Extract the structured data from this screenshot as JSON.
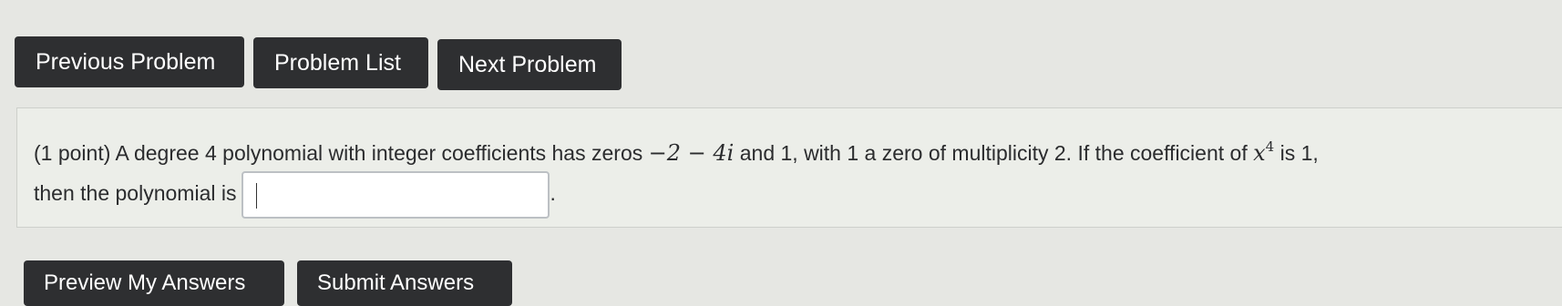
{
  "nav": {
    "previous_label": "Previous Problem",
    "list_label": "Problem List",
    "next_label": "Next Problem"
  },
  "problem": {
    "points": "(1 point)",
    "text_part1": " A degree 4 polynomial with integer coefficients has zeros ",
    "zero_complex": "−2 − 4i",
    "text_part2": " and 1, with 1 a zero of multiplicity 2. If the coefficient of ",
    "x_var": "x",
    "x_exponent": "4",
    "text_part3": " is 1,",
    "line2_text": "then the polynomial is",
    "answer_value": "",
    "answer_trailing": "."
  },
  "actions": {
    "preview_label": "Preview My Answers",
    "submit_label": "Submit Answers"
  }
}
